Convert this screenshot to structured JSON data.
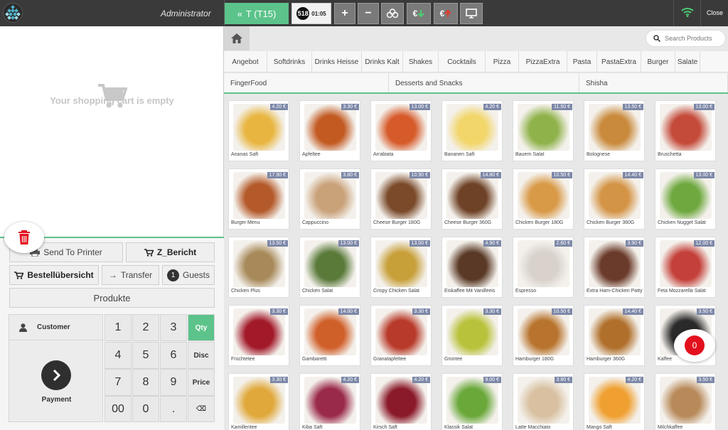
{
  "topbar": {
    "user": "Administrator",
    "table_label": "T (T15)",
    "order_count": "518",
    "time": "01:05",
    "close": "Close"
  },
  "cart": {
    "empty_text": "Your shopping cart is empty"
  },
  "actions": {
    "send_to_printer": "Send To Printer",
    "z_bericht": "Z_Bericht",
    "bestelluebersicht": "Bestellübersicht",
    "transfer": "Transfer",
    "guests_count": "1",
    "guests": "Guests",
    "produkte": "Produkte"
  },
  "keypad": {
    "customer": "Customer",
    "payment": "Payment",
    "keys": [
      "1",
      "2",
      "3",
      "Qty",
      "4",
      "5",
      "6",
      "Disc",
      "7",
      "8",
      "9",
      "Price",
      "00",
      "0",
      ".",
      "⌫"
    ]
  },
  "search": {
    "placeholder": "Search Products"
  },
  "categories": [
    "Angebot",
    "Softdrinks",
    "Drinks Heisse",
    "Drinks Kalt",
    "Shakes",
    "Cocktails",
    "Pizza",
    "PizzaExtra",
    "Pasta",
    "PastaExtra",
    "Burger",
    "Salate"
  ],
  "categories2": [
    "FingerFood",
    "Desserts and Snacks",
    "Shisha"
  ],
  "products": [
    {
      "name": "Ananas Saft",
      "price": "4.20 €",
      "color": "#e8b640"
    },
    {
      "name": "Apfeltee",
      "price": "3.30 €",
      "color": "#c25a22"
    },
    {
      "name": "Arrabiata",
      "price": "13.00 €",
      "color": "#d65a2a"
    },
    {
      "name": "Bananen Saft",
      "price": "4.20 €",
      "color": "#f2d66a"
    },
    {
      "name": "Bauern Salat",
      "price": "11.50 €",
      "color": "#8fb24a"
    },
    {
      "name": "Bolognese",
      "price": "13.50 €",
      "color": "#c98a3c"
    },
    {
      "name": "Bruschetta",
      "price": "13.00 €",
      "color": "#c44a3a"
    },
    {
      "name": "Burger Menu",
      "price": "17.90 €",
      "color": "#b45a2a"
    },
    {
      "name": "Cappuccino",
      "price": "3.80 €",
      "color": "#c9a27a"
    },
    {
      "name": "Cheese Burger 180G",
      "price": "10.90 €",
      "color": "#7a4a2a"
    },
    {
      "name": "Cheese Burger 360G",
      "price": "14.80 €",
      "color": "#6e4226"
    },
    {
      "name": "Chicken Burger 180G",
      "price": "10.50 €",
      "color": "#d99a48"
    },
    {
      "name": "Chicken Burger 360G",
      "price": "14.40 €",
      "color": "#d49446"
    },
    {
      "name": "Chicken Nugget Salat",
      "price": "13.00 €",
      "color": "#6ea83e"
    },
    {
      "name": "Chicken Plus",
      "price": "13.50 €",
      "color": "#a88a5a"
    },
    {
      "name": "Chicken Salat",
      "price": "13.00 €",
      "color": "#5a7a3a"
    },
    {
      "name": "Crispy Chicken Salat",
      "price": "13.00 €",
      "color": "#c8a03a"
    },
    {
      "name": "Eiskaffee Mit Vanilleeis",
      "price": "4.90 €",
      "color": "#5a3a26"
    },
    {
      "name": "Espresso",
      "price": "2.60 €",
      "color": "#d9d2cc"
    },
    {
      "name": "Extra Ham-Chicken Patty",
      "price": "3.90 €",
      "color": "#6a3a2a"
    },
    {
      "name": "Feta Mozzarella Salat",
      "price": "12.00 €",
      "color": "#c4403a"
    },
    {
      "name": "Früchtetee",
      "price": "3.30 €",
      "color": "#a21a2a"
    },
    {
      "name": "Gambaretti",
      "price": "14.00 €",
      "color": "#d0602a"
    },
    {
      "name": "Granatapfeltee",
      "price": "3.30 €",
      "color": "#b83a2a"
    },
    {
      "name": "Grüntee",
      "price": "3.30 €",
      "color": "#b8c23a"
    },
    {
      "name": "Hamburger 180G",
      "price": "10.50 €",
      "color": "#b8742e"
    },
    {
      "name": "Hamburger 360G",
      "price": "14.40 €",
      "color": "#b0702c"
    },
    {
      "name": "Kaffee",
      "price": "3.50 €",
      "color": "#2a2a2a"
    },
    {
      "name": "Kamillentee",
      "price": "3.30 €",
      "color": "#e0a83a"
    },
    {
      "name": "Kiba Saft",
      "price": "4.20 €",
      "color": "#9a2a4a"
    },
    {
      "name": "Kirsch Saft",
      "price": "4.20 €",
      "color": "#8a1a2a"
    },
    {
      "name": "Klassik Salat",
      "price": "9.00 €",
      "color": "#6aa83a"
    },
    {
      "name": "Latte Macchiato",
      "price": "3.80 €",
      "color": "#d8c0a0"
    },
    {
      "name": "Mango Saft",
      "price": "4.20 €",
      "color": "#f0a030"
    },
    {
      "name": "Milchkaffee",
      "price": "3.50 €",
      "color": "#b88a5a"
    }
  ],
  "cart_count": "0"
}
